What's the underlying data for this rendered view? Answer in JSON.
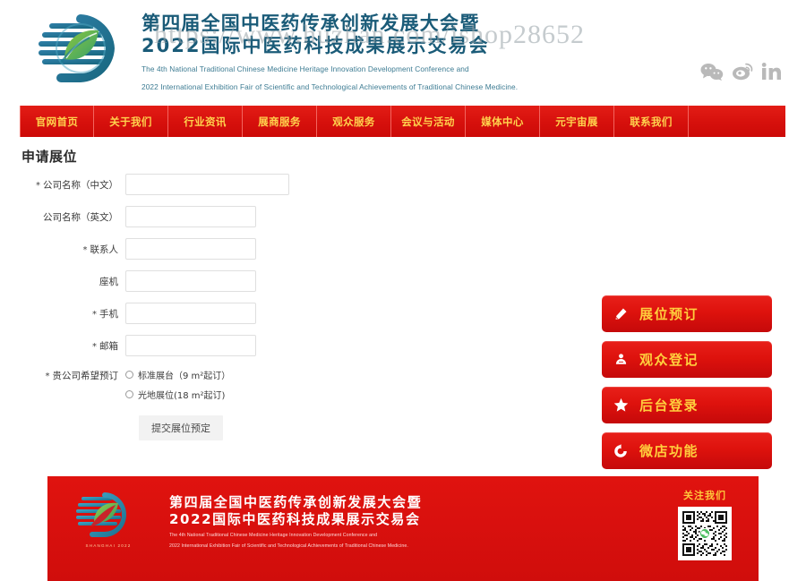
{
  "header": {
    "logo_icon": "tcm-hand-leaf-logo",
    "title_line1": "第四届全国中医药传承创新发展大会暨",
    "title_line2": "2022国际中医药科技成果展示交易会",
    "subtitle_line1": "The 4th National Traditional Chinese Medicine Heritage Innovation Development Conference and",
    "subtitle_line2": "2022 International Exhibition Fair of Scientific and Technological Achievements of Traditional Chinese Medicine.",
    "watermark": "https://www.huzhan.com/ishop28652",
    "social": [
      {
        "name": "wechat-icon",
        "label": "WeChat"
      },
      {
        "name": "weibo-icon",
        "label": "Weibo"
      },
      {
        "name": "linkedin-icon",
        "label": "LinkedIn"
      }
    ]
  },
  "nav": {
    "items": [
      {
        "label": "官网首页"
      },
      {
        "label": "关于我们"
      },
      {
        "label": "行业资讯"
      },
      {
        "label": "展商服务"
      },
      {
        "label": "观众服务"
      },
      {
        "label": "会议与活动"
      },
      {
        "label": "媒体中心"
      },
      {
        "label": "元宇宙展"
      },
      {
        "label": "联系我们"
      }
    ]
  },
  "main": {
    "section_title": "申请展位",
    "fields": [
      {
        "label": "公司名称（中文）",
        "required": true,
        "value": "",
        "placeholder": "",
        "width": "wide"
      },
      {
        "label": "公司名称（英文）",
        "required": false,
        "value": "",
        "placeholder": "",
        "width": "std"
      },
      {
        "label": "联系人",
        "required": true,
        "value": "",
        "placeholder": "",
        "width": "std"
      },
      {
        "label": "座机",
        "required": false,
        "value": "",
        "placeholder": "",
        "width": "std"
      },
      {
        "label": "手机",
        "required": true,
        "value": "",
        "placeholder": "",
        "width": "std"
      },
      {
        "label": "邮箱",
        "required": true,
        "value": "",
        "placeholder": "",
        "width": "std"
      }
    ],
    "booth_choice": {
      "label": "贵公司希望预订",
      "required": true,
      "options": [
        {
          "label": "标准展台（9 m²起订）",
          "selected": false
        },
        {
          "label": "光地展位(18 m²起订)",
          "selected": false
        }
      ]
    },
    "submit_label": "提交展位预定"
  },
  "sidebar": {
    "buttons": [
      {
        "label": "展位预订",
        "icon": "ticket-icon"
      },
      {
        "label": "观众登记",
        "icon": "badge-icon"
      },
      {
        "label": "后台登录",
        "icon": "star-icon"
      },
      {
        "label": "微店功能",
        "icon": "refresh-icon"
      }
    ]
  },
  "footer": {
    "logo_icon": "tcm-hand-leaf-logo",
    "logo_caption": "SHANGHAI 2022",
    "title_line1": "第四届全国中医药传承创新发展大会暨",
    "title_line2": "2022国际中医药科技成果展示交易会",
    "subtitle_line1": "The 4th National Traditional Chinese Medicine Heritage Innovation Development Conference and",
    "subtitle_line2": "2022 International Exhibition Fair of Scientific and Technological Achievements of Traditional Chinese Medicine.",
    "qr_title": "关注我们",
    "qr_icon": "wechat-qr-code"
  },
  "colors": {
    "brand_red": "#d6100c",
    "nav_gold": "#ffd34d",
    "side_gold": "#ffcf3d",
    "logo_teal": "#1a5b78",
    "logo_green": "#6cb33f"
  }
}
